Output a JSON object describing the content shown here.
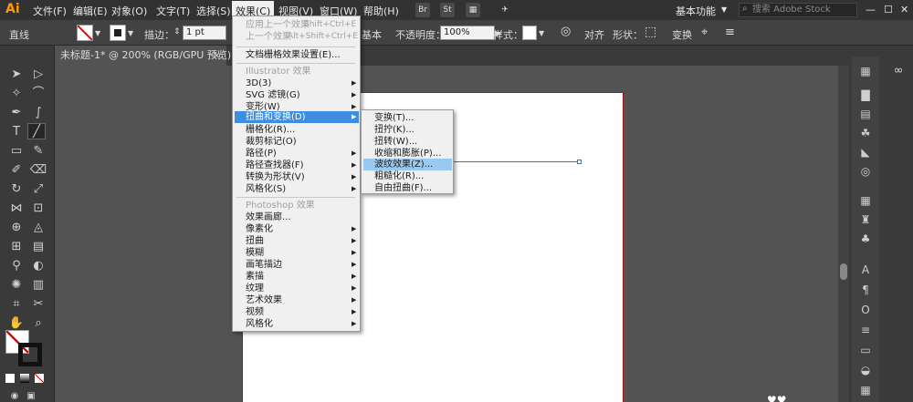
{
  "app": {
    "logo": "Ai"
  },
  "menubar": {
    "items": [
      "文件(F)",
      "编辑(E)",
      "对象(O)",
      "文字(T)",
      "选择(S)",
      "效果(C)",
      "视图(V)",
      "窗口(W)",
      "帮助(H)"
    ],
    "bridge_icon": "Br",
    "stock_icon": "St",
    "workspace": "基本功能",
    "search_placeholder": "搜索 Adobe Stock"
  },
  "control_bar": {
    "tool_name": "直线",
    "stroke_label": "描边：",
    "stroke_value": "1 pt",
    "style_partial": "基本",
    "opacity_label": "不透明度：",
    "opacity_value": "100%",
    "style_label": "样式：",
    "align_label": "对齐",
    "shape_label": "形状：",
    "transform_label": "变换"
  },
  "document_tab": {
    "title": "未标题-1* @ 200% (RGB/GPU 预览)",
    "close": "×"
  },
  "effect_menu": {
    "apply_last": "应用上一个效果",
    "apply_last_shortcut": "Shift+Ctrl+E",
    "last_effect": "上一个效果",
    "last_effect_shortcut": "Alt+Shift+Ctrl+E",
    "raster_settings": "文档栅格效果设置(E)...",
    "illustrator_header": "Illustrator 效果",
    "illustrator_items": [
      "3D(3)",
      "SVG 滤镜(G)",
      "变形(W)",
      "扭曲和变换(D)",
      "栅格化(R)...",
      "裁剪标记(O)",
      "路径(P)",
      "路径查找器(F)",
      "转换为形状(V)",
      "风格化(S)"
    ],
    "photoshop_header": "Photoshop 效果",
    "photoshop_items": [
      "效果画廊...",
      "像素化",
      "扭曲",
      "模糊",
      "画笔描边",
      "素描",
      "纹理",
      "艺术效果",
      "视频",
      "风格化"
    ]
  },
  "distort_submenu": {
    "items": [
      "变换(T)...",
      "扭拧(K)...",
      "扭转(W)...",
      "收缩和膨胀(P)...",
      "波纹效果(Z)...",
      "粗糙化(R)...",
      "自由扭曲(F)..."
    ]
  },
  "colors": {
    "menubar_bg": "#323232",
    "accent_highlight": "#3d8ee0",
    "submenu_highlight": "#99c9f0",
    "artboard_border": "#a01b1b",
    "path_color": "#4a6db5",
    "logo_color": "#ff9a00"
  }
}
